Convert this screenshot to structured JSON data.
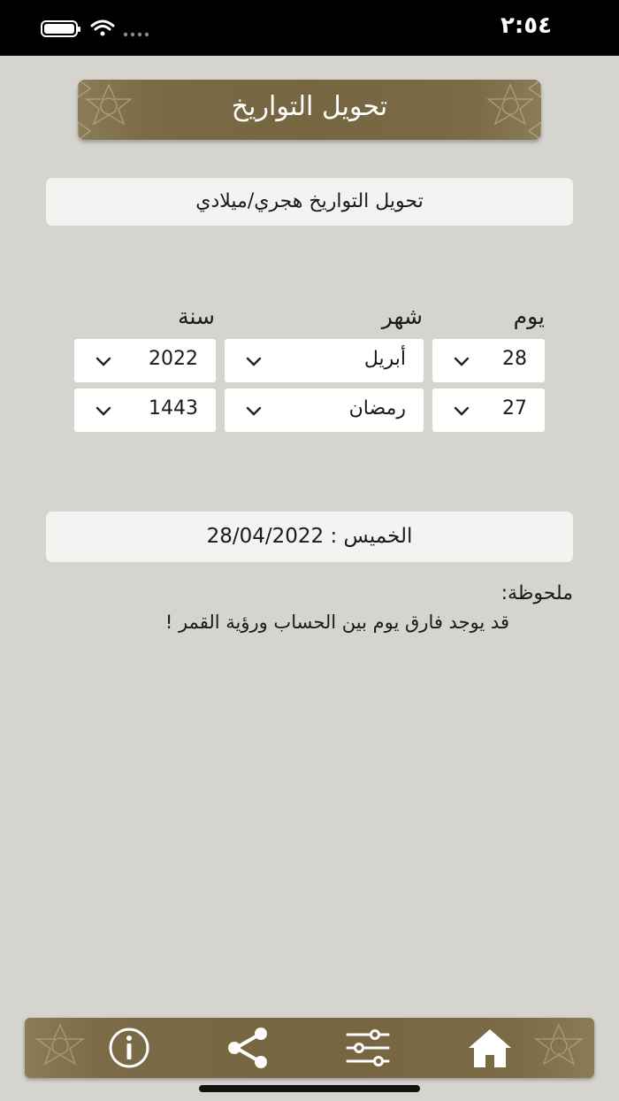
{
  "status_bar": {
    "time": "٢:٥٤"
  },
  "header": {
    "title": "تحويل التواريخ"
  },
  "mode": {
    "label": "تحويل التواريخ هجري/ميلادي"
  },
  "columns": {
    "day": "يوم",
    "month": "شهر",
    "year": "سنة"
  },
  "gregorian": {
    "day": "28",
    "month": "أبريل",
    "year": "2022"
  },
  "hijri": {
    "day": "27",
    "month": "رمضان",
    "year": "1443"
  },
  "result": {
    "text": "الخميس : 28/04/2022"
  },
  "note": {
    "label": "ملحوظة:",
    "text": "قد يوجد فارق يوم بين الحساب ورؤية القمر !"
  },
  "tabbar": {
    "items": [
      "home-icon",
      "sliders-icon",
      "share-icon",
      "info-icon"
    ]
  },
  "colors": {
    "accent": "#756641",
    "background": "#d5d4cf",
    "card": "#f3f3f2"
  }
}
